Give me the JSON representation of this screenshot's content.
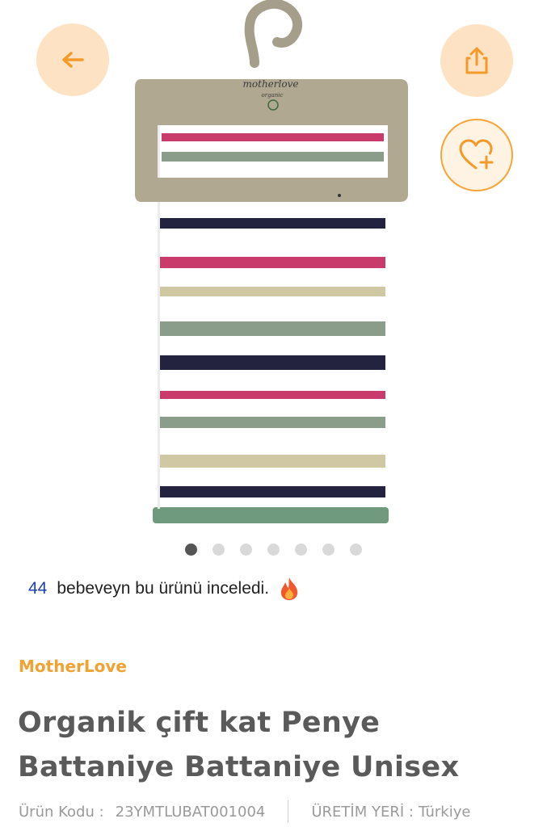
{
  "gallery": {
    "image_alt": "mother love organic striped blanket on hanger",
    "hanger_brand": "motherlove",
    "hanger_sub": "organic",
    "dots_total": 7,
    "dots_active": 1
  },
  "buttons": {
    "back_icon": "arrow-left-icon",
    "share_icon": "share-icon",
    "favorite_icon": "heart-plus-icon"
  },
  "viewers": {
    "count": "44",
    "text": "bebeveyn bu ürünü inceledi.",
    "icon": "fire-icon"
  },
  "product": {
    "brand": "MotherLove",
    "title_line1": "Organik çift kat Penye",
    "title_line2": "Battaniye Battaniye Unisex",
    "code_label": "Ürün Kodu :",
    "code_value": "23YMTLUBAT001004",
    "origin_label": "ÜRETİM YERİ :",
    "origin_value": "Türkiye"
  },
  "colors": {
    "accent": "#f0a233",
    "button_bg": "#fde3c3",
    "stripe_pink": "#c93b6a",
    "stripe_navy": "#24233f",
    "stripe_green": "#8a9c8a",
    "stripe_beige": "#cfc8a2"
  }
}
